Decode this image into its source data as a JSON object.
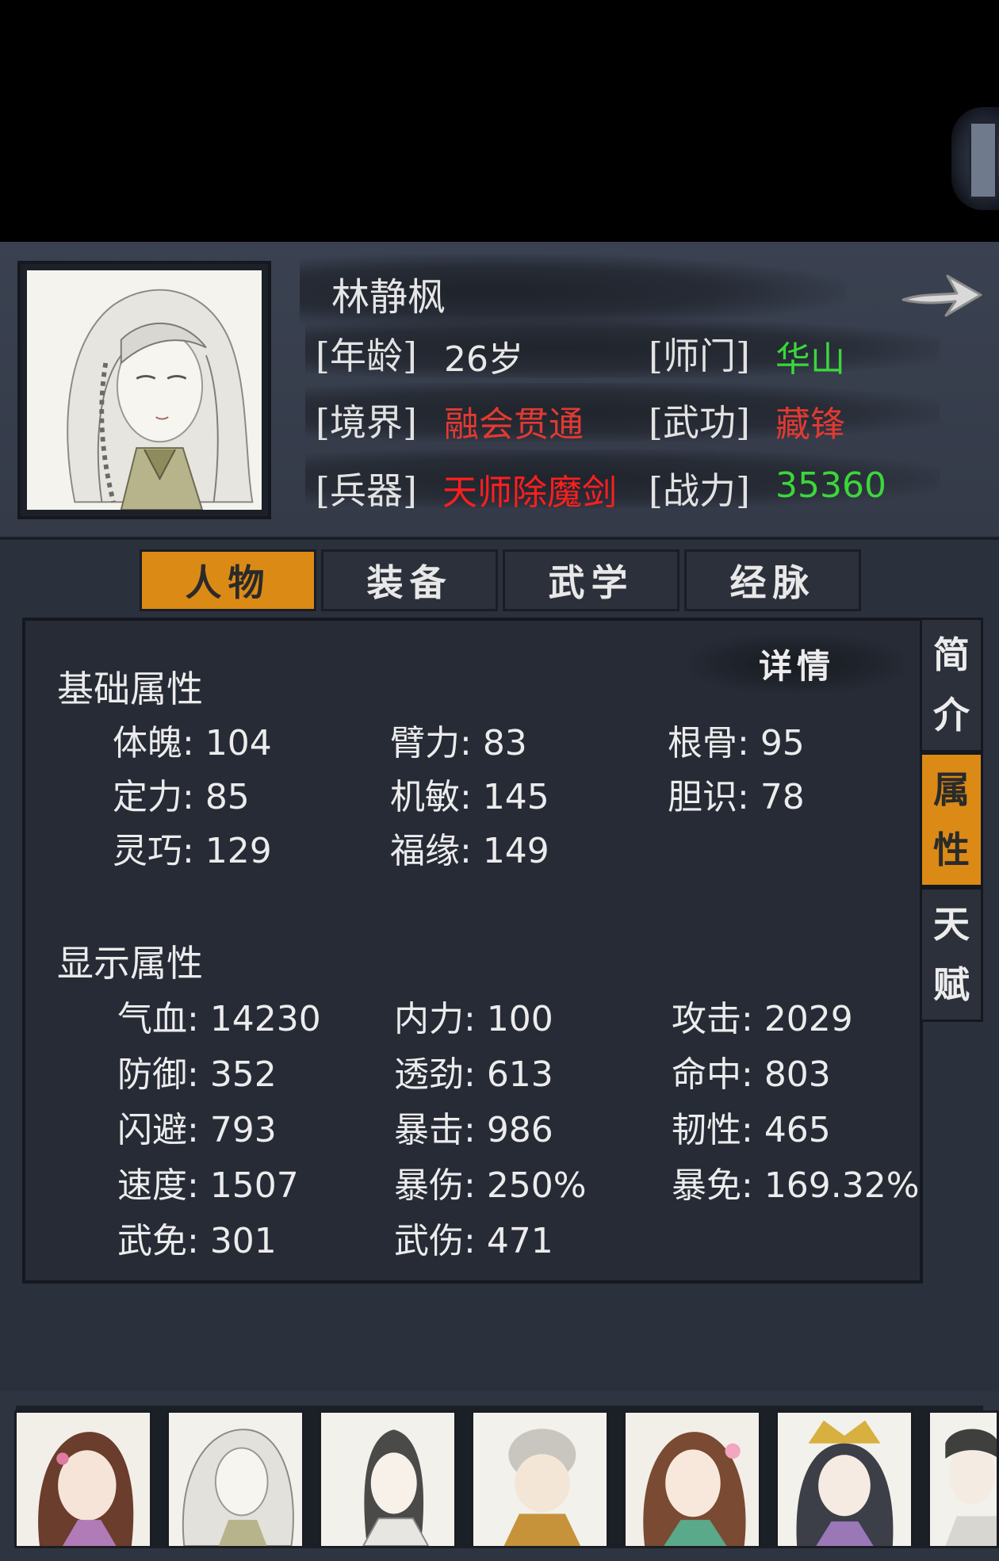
{
  "character": {
    "name": "林静枫",
    "age_label": "[年龄]",
    "age_value": "26岁",
    "sect_label": "[师门]",
    "sect_value": "华山",
    "realm_label": "[境界]",
    "realm_value": "融会贯通",
    "skill_label": "[武功]",
    "skill_value": "藏锋",
    "weapon_label": "[兵器]",
    "weapon_value": "天师除魔剑",
    "power_label": "[战力]",
    "power_value": "35360"
  },
  "tabs": [
    {
      "label": "人物",
      "active": true
    },
    {
      "label": "装备",
      "active": false
    },
    {
      "label": "武学",
      "active": false
    },
    {
      "label": "经脉",
      "active": false
    }
  ],
  "side_tabs": [
    {
      "chars": [
        "简",
        "介"
      ],
      "active": false
    },
    {
      "chars": [
        "属",
        "性"
      ],
      "active": true
    },
    {
      "chars": [
        "天",
        "赋"
      ],
      "active": false
    }
  ],
  "basic": {
    "title": "基础属性",
    "detail_label": "详情",
    "stats": [
      {
        "label": "体魄",
        "value": "104"
      },
      {
        "label": "臂力",
        "value": "83"
      },
      {
        "label": "根骨",
        "value": "95"
      },
      {
        "label": "定力",
        "value": "85"
      },
      {
        "label": "机敏",
        "value": "145"
      },
      {
        "label": "胆识",
        "value": "78"
      },
      {
        "label": "灵巧",
        "value": "129"
      },
      {
        "label": "福缘",
        "value": "149"
      }
    ]
  },
  "display": {
    "title": "显示属性",
    "stats": [
      {
        "label": "气血",
        "value": "14230"
      },
      {
        "label": "内力",
        "value": "100"
      },
      {
        "label": "攻击",
        "value": "2029"
      },
      {
        "label": "防御",
        "value": "352"
      },
      {
        "label": "透劲",
        "value": "613"
      },
      {
        "label": "命中",
        "value": "803"
      },
      {
        "label": "闪避",
        "value": "793"
      },
      {
        "label": "暴击",
        "value": "986"
      },
      {
        "label": "韧性",
        "value": "465"
      },
      {
        "label": "速度",
        "value": "1507"
      },
      {
        "label": "暴伤",
        "value": "250%"
      },
      {
        "label": "暴免",
        "value": "169.32%"
      },
      {
        "label": "武免",
        "value": "301"
      },
      {
        "label": "武伤",
        "value": "471"
      }
    ]
  },
  "party": [
    {
      "icon": "female-portrait-icon"
    },
    {
      "icon": "lin-jingfeng-portrait-icon"
    },
    {
      "icon": "male-swordsman-portrait-icon"
    },
    {
      "icon": "monk-portrait-icon"
    },
    {
      "icon": "female-flower-portrait-icon"
    },
    {
      "icon": "crowned-female-portrait-icon"
    },
    {
      "icon": "male-portrait-icon"
    }
  ],
  "colors": {
    "accent": "#dc8a16",
    "green": "#3cd63c",
    "red": "#e03a32",
    "bright_red": "#ff1e1e"
  }
}
